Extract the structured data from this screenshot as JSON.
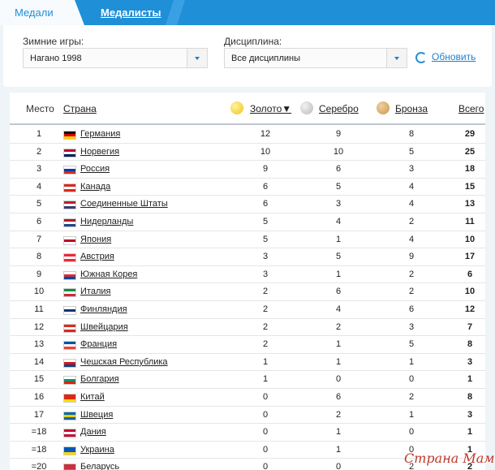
{
  "tabs": {
    "medals": "Медали",
    "medalists": "Медалисты"
  },
  "filters": {
    "games_label": "Зимние игры:",
    "games_value": "Нагано 1998",
    "discipline_label": "Дисциплина:",
    "discipline_value": "Все дисциплины",
    "refresh": "Обновить"
  },
  "table": {
    "headers": {
      "place": "Место",
      "country": "Страна",
      "gold": "Золото▼",
      "silver": "Серебро",
      "bronze": "Бронза",
      "total": "Всего"
    },
    "rows": [
      {
        "rank": "1",
        "country": "Германия",
        "gold": "12",
        "silver": "9",
        "bronze": "8",
        "total": "29"
      },
      {
        "rank": "2",
        "country": "Норвегия",
        "gold": "10",
        "silver": "10",
        "bronze": "5",
        "total": "25"
      },
      {
        "rank": "3",
        "country": "Россия",
        "gold": "9",
        "silver": "6",
        "bronze": "3",
        "total": "18"
      },
      {
        "rank": "4",
        "country": "Канада",
        "gold": "6",
        "silver": "5",
        "bronze": "4",
        "total": "15"
      },
      {
        "rank": "5",
        "country": "Соединенные Штаты",
        "gold": "6",
        "silver": "3",
        "bronze": "4",
        "total": "13"
      },
      {
        "rank": "6",
        "country": "Нидерланды",
        "gold": "5",
        "silver": "4",
        "bronze": "2",
        "total": "11"
      },
      {
        "rank": "7",
        "country": "Япония",
        "gold": "5",
        "silver": "1",
        "bronze": "4",
        "total": "10"
      },
      {
        "rank": "8",
        "country": "Австрия",
        "gold": "3",
        "silver": "5",
        "bronze": "9",
        "total": "17"
      },
      {
        "rank": "9",
        "country": "Южная Корея",
        "gold": "3",
        "silver": "1",
        "bronze": "2",
        "total": "6"
      },
      {
        "rank": "10",
        "country": "Италия",
        "gold": "2",
        "silver": "6",
        "bronze": "2",
        "total": "10"
      },
      {
        "rank": "11",
        "country": "Финляндия",
        "gold": "2",
        "silver": "4",
        "bronze": "6",
        "total": "12"
      },
      {
        "rank": "12",
        "country": "Швейцария",
        "gold": "2",
        "silver": "2",
        "bronze": "3",
        "total": "7"
      },
      {
        "rank": "13",
        "country": "Франция",
        "gold": "2",
        "silver": "1",
        "bronze": "5",
        "total": "8"
      },
      {
        "rank": "14",
        "country": "Чешская Республика",
        "gold": "1",
        "silver": "1",
        "bronze": "1",
        "total": "3"
      },
      {
        "rank": "15",
        "country": "Болгария",
        "gold": "1",
        "silver": "0",
        "bronze": "0",
        "total": "1"
      },
      {
        "rank": "16",
        "country": "Китай",
        "gold": "0",
        "silver": "6",
        "bronze": "2",
        "total": "8"
      },
      {
        "rank": "17",
        "country": "Швеция",
        "gold": "0",
        "silver": "2",
        "bronze": "1",
        "total": "3"
      },
      {
        "rank": "=18",
        "country": "Дания",
        "gold": "0",
        "silver": "1",
        "bronze": "0",
        "total": "1"
      },
      {
        "rank": "=18",
        "country": "Украина",
        "gold": "0",
        "silver": "1",
        "bronze": "0",
        "total": "1"
      },
      {
        "rank": "=20",
        "country": "Беларусь",
        "gold": "0",
        "silver": "0",
        "bronze": "2",
        "total": "2"
      }
    ]
  },
  "flags": [
    [
      "#111",
      "#d00",
      "#fc0"
    ],
    [
      "#ba0c2f",
      "#fff",
      "#00205b"
    ],
    [
      "#fff",
      "#0039a6",
      "#d52b1e"
    ],
    [
      "#d52b1e",
      "#fff",
      "#d52b1e"
    ],
    [
      "#b22234",
      "#fff",
      "#3c3b6e"
    ],
    [
      "#ae1c28",
      "#fff",
      "#21468b"
    ],
    [
      "#fff",
      "#bc002d",
      "#fff"
    ],
    [
      "#ed2939",
      "#fff",
      "#ed2939"
    ],
    [
      "#fff",
      "#cd2e3a",
      "#0047a0"
    ],
    [
      "#009246",
      "#fff",
      "#ce2b37"
    ],
    [
      "#fff",
      "#003580",
      "#fff"
    ],
    [
      "#d52b1e",
      "#fff",
      "#d52b1e"
    ],
    [
      "#0055a4",
      "#fff",
      "#ef4135"
    ],
    [
      "#fff",
      "#d7141a",
      "#11457e"
    ],
    [
      "#fff",
      "#00966e",
      "#d62612"
    ],
    [
      "#de2910",
      "#de2910",
      "#ffde00"
    ],
    [
      "#006aa7",
      "#fecc00",
      "#006aa7"
    ],
    [
      "#c60c30",
      "#fff",
      "#c60c30"
    ],
    [
      "#0057b7",
      "#0057b7",
      "#ffd700"
    ],
    [
      "#c8313e",
      "#c8313e",
      "#4aa657"
    ]
  ],
  "medal_colors": {
    "gold": "#f2c21c",
    "silver": "#b9b9b9",
    "bronze": "#c9964a"
  },
  "watermark": "Страна Мам"
}
